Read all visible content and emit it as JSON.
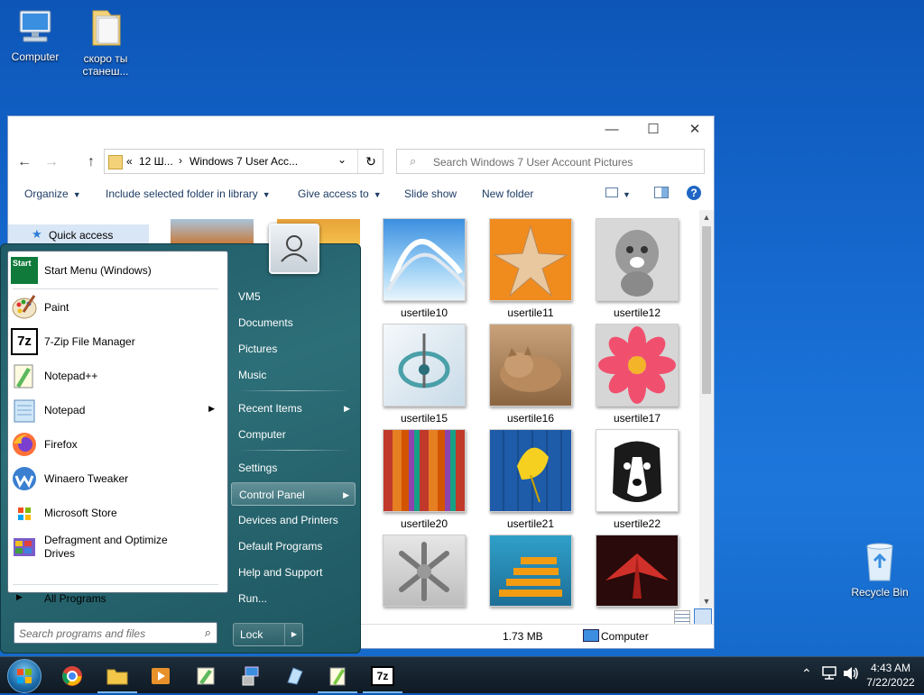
{
  "desktop": {
    "icons": [
      {
        "label": "Computer"
      },
      {
        "label": "скоро ты станеш..."
      },
      {
        "label": "Recycle Bin"
      }
    ]
  },
  "explorer": {
    "title_buttons": {
      "minimize": "—",
      "maximize": "☐",
      "close": "✕"
    },
    "address": {
      "chevron": "«",
      "crumb1": "12 Ш...",
      "sep": "›",
      "crumb2": "Windows 7 User Acc..."
    },
    "search_placeholder": "Search Windows 7 User Account Pictures",
    "toolbar": {
      "organize": "Organize",
      "include": "Include selected folder in library",
      "give_access": "Give access to",
      "slide_show": "Slide show",
      "new_folder": "New folder"
    },
    "nav": {
      "quick_access": "Quick access"
    },
    "thumbnails": [
      {
        "label": "usertile10"
      },
      {
        "label": "usertile11"
      },
      {
        "label": "usertile12"
      },
      {
        "label": "usertile15"
      },
      {
        "label": "usertile16"
      },
      {
        "label": "usertile17"
      },
      {
        "label": "usertile20"
      },
      {
        "label": "usertile21"
      },
      {
        "label": "usertile22"
      },
      {
        "label": ""
      },
      {
        "label": ""
      },
      {
        "label": ""
      }
    ],
    "status": {
      "size": "1.73 MB",
      "location": "Computer"
    }
  },
  "start_menu": {
    "programs": [
      {
        "label": "Start Menu (Windows)",
        "submenu": false
      },
      {
        "label": "Paint",
        "submenu": false
      },
      {
        "label": "7-Zip File Manager",
        "submenu": false
      },
      {
        "label": "Notepad++",
        "submenu": false
      },
      {
        "label": "Notepad",
        "submenu": true
      },
      {
        "label": "Firefox",
        "submenu": false
      },
      {
        "label": "Winaero Tweaker",
        "submenu": false
      },
      {
        "label": "Microsoft Store",
        "submenu": false
      },
      {
        "label": "Defragment and Optimize Drives",
        "submenu": false
      }
    ],
    "start_tile_text": "Start",
    "all_programs": "All Programs",
    "search_placeholder": "Search programs and files",
    "right_items": [
      {
        "label": "VM5"
      },
      {
        "label": "Documents"
      },
      {
        "label": "Pictures"
      },
      {
        "label": "Music"
      },
      {
        "label": "Recent Items"
      },
      {
        "label": "Computer"
      },
      {
        "label": "Settings"
      },
      {
        "label": "Control Panel"
      },
      {
        "label": "Devices and Printers"
      },
      {
        "label": "Default Programs"
      },
      {
        "label": "Help and Support"
      },
      {
        "label": "Run..."
      }
    ],
    "lock": "Lock"
  },
  "taskbar": {
    "time": "4:43 AM",
    "date": "7/22/2022",
    "zip_label": "7z"
  },
  "colors": {
    "desktop": "#1669cf",
    "start_menu": "#2d6f78",
    "taskbar": "#16222e",
    "accent_link": "#1e3c64"
  }
}
